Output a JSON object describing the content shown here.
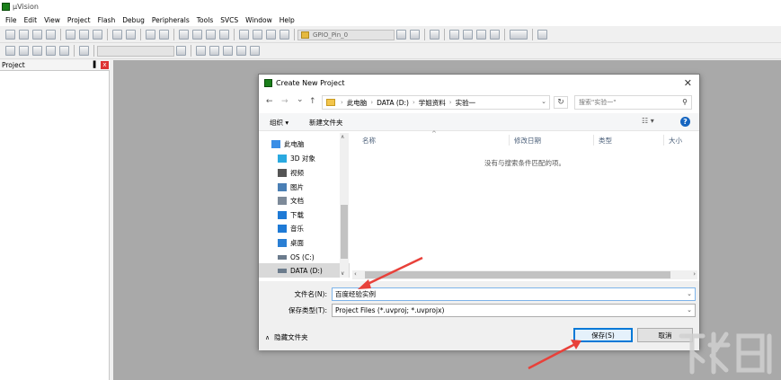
{
  "window": {
    "title": "µVision"
  },
  "menu": [
    "File",
    "Edit",
    "View",
    "Project",
    "Flash",
    "Debug",
    "Peripherals",
    "Tools",
    "SVCS",
    "Window",
    "Help"
  ],
  "toolbar": {
    "target_combo": "GPIO_Pin_0"
  },
  "project_panel": {
    "title": "Project",
    "pin": "▐",
    "close": "x"
  },
  "dialog": {
    "title": "Create New Project",
    "close": "✕",
    "nav": {
      "back": "←",
      "forward": "→",
      "recent": "⌄",
      "up": "↑"
    },
    "breadcrumb": [
      "此电脑",
      "DATA (D:)",
      "学姐资料",
      "实验一"
    ],
    "search_placeholder": "搜索\"实验一\"",
    "commands": {
      "organize": "组织 ▾",
      "new_folder": "新建文件夹"
    },
    "view_toggle": "☷ ▾",
    "help": "?",
    "nav_items": [
      {
        "label": "此电脑",
        "icon": "computer-icon",
        "color": "#3a8ee6"
      },
      {
        "label": "3D 对象",
        "icon": "cube-icon",
        "color": "#2aa9e0"
      },
      {
        "label": "视频",
        "icon": "video-icon",
        "color": "#555555"
      },
      {
        "label": "图片",
        "icon": "picture-icon",
        "color": "#4a7fb5"
      },
      {
        "label": "文档",
        "icon": "document-icon",
        "color": "#7d8a99"
      },
      {
        "label": "下载",
        "icon": "download-icon",
        "color": "#1e7ad6"
      },
      {
        "label": "音乐",
        "icon": "music-icon",
        "color": "#1e7ad6"
      },
      {
        "label": "桌面",
        "icon": "desktop-icon",
        "color": "#2a7fd4"
      },
      {
        "label": "OS (C:)",
        "icon": "drive-icon",
        "color": "#6b7b8c"
      },
      {
        "label": "DATA (D:)",
        "icon": "drive-icon",
        "color": "#6b7b8c"
      }
    ],
    "columns": [
      "名称",
      "修改日期",
      "类型",
      "大小"
    ],
    "empty_message": "没有与搜索条件匹配的项。",
    "filename_label": "文件名(N):",
    "filename_value": "百度经验实例",
    "filetype_label": "保存类型(T):",
    "filetype_value": "Project Files (*.uvproj; *.uvprojx)",
    "hide_folders": "隐藏文件夹",
    "save_button": "保存(S)",
    "cancel_button": "取消"
  },
  "watermark": {
    "text": "下载吧"
  },
  "colors": {
    "arrow": "#e8413a",
    "accent": "#0078d7",
    "workspace": "#a9a9a9"
  }
}
